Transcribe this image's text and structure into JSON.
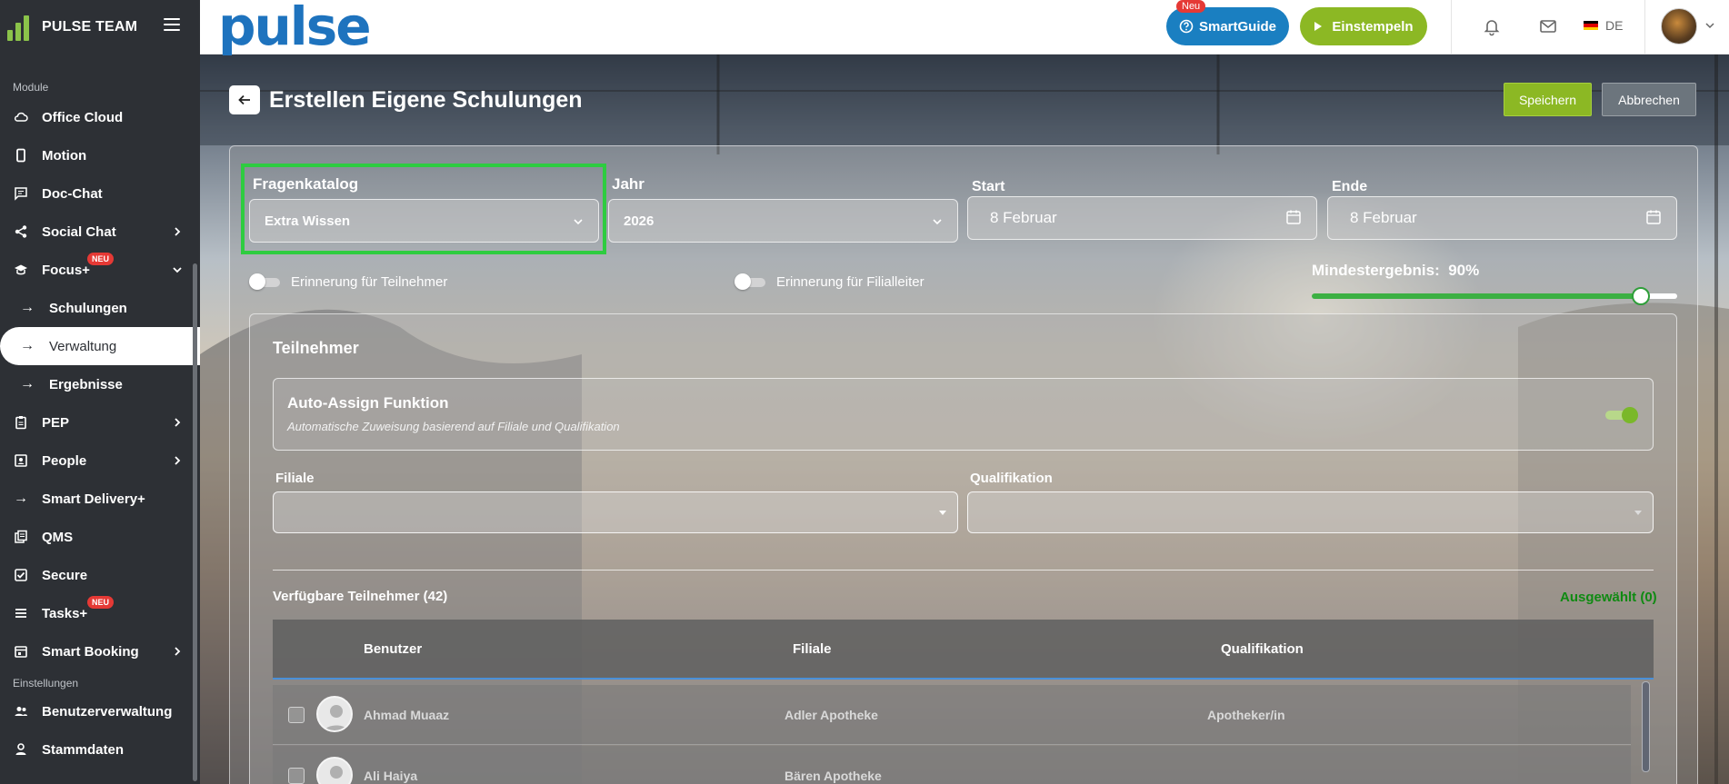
{
  "sidebar": {
    "brand": "PULSE TEAM",
    "section_modules": "Module",
    "section_settings": "Einstellungen",
    "items": [
      {
        "label": "Office Cloud"
      },
      {
        "label": "Motion"
      },
      {
        "label": "Doc-Chat"
      },
      {
        "label": "Social Chat"
      },
      {
        "label": "Focus+",
        "badge": "NEU"
      },
      {
        "label": "Schulungen"
      },
      {
        "label": "Verwaltung"
      },
      {
        "label": "Ergebnisse"
      },
      {
        "label": "PEP"
      },
      {
        "label": "People"
      },
      {
        "label": "Smart Delivery+"
      },
      {
        "label": "QMS"
      },
      {
        "label": "Secure"
      },
      {
        "label": "Tasks+",
        "badge": "NEU"
      },
      {
        "label": "Smart Booking"
      },
      {
        "label": "Benutzerverwaltung"
      },
      {
        "label": "Stammdaten"
      }
    ]
  },
  "topbar": {
    "logo": "pulse",
    "smartguide_badge": "Neu",
    "smartguide": "SmartGuide",
    "einstempeln": "Einstempeln",
    "lang": "DE"
  },
  "page": {
    "title": "Erstellen Eigene Schulungen",
    "save": "Speichern",
    "cancel": "Abbrechen"
  },
  "form": {
    "fragenkatalog_label": "Fragenkatalog",
    "fragenkatalog_value": "Extra Wissen",
    "jahr_label": "Jahr",
    "jahr_value": "2026",
    "start_label": "Start",
    "start_value": "8 Februar",
    "ende_label": "Ende",
    "ende_value": "8 Februar",
    "reminder_participants": "Erinnerung für Teilnehmer",
    "reminder_branch_manager": "Erinnerung für Filialleiter",
    "min_result_label": "Mindestergebnis:",
    "min_result_value": "90%",
    "min_result_fraction": 0.9
  },
  "participants": {
    "title": "Teilnehmer",
    "auto_assign_title": "Auto-Assign Funktion",
    "auto_assign_desc": "Automatische Zuweisung basierend auf Filiale und Qualifikation",
    "filiale_label": "Filiale",
    "qualifikation_label": "Qualifikation",
    "available": "Verfügbare Teilnehmer (42)",
    "selected": "Ausgewählt (0)",
    "columns": [
      "Benutzer",
      "Filiale",
      "Qualifikation"
    ],
    "rows": [
      {
        "name": "Ahmad Muaaz",
        "filiale": "Adler Apotheke",
        "qualifikation": "Apotheker/in"
      },
      {
        "name": "Ali Haiya",
        "filiale": "Bären Apotheke",
        "qualifikation": ""
      }
    ]
  },
  "colors": {
    "accent_green": "#8cb824",
    "accent_blue": "#1a7fc1",
    "sidebar": "#2d3035",
    "highlight": "#2ecc40"
  }
}
